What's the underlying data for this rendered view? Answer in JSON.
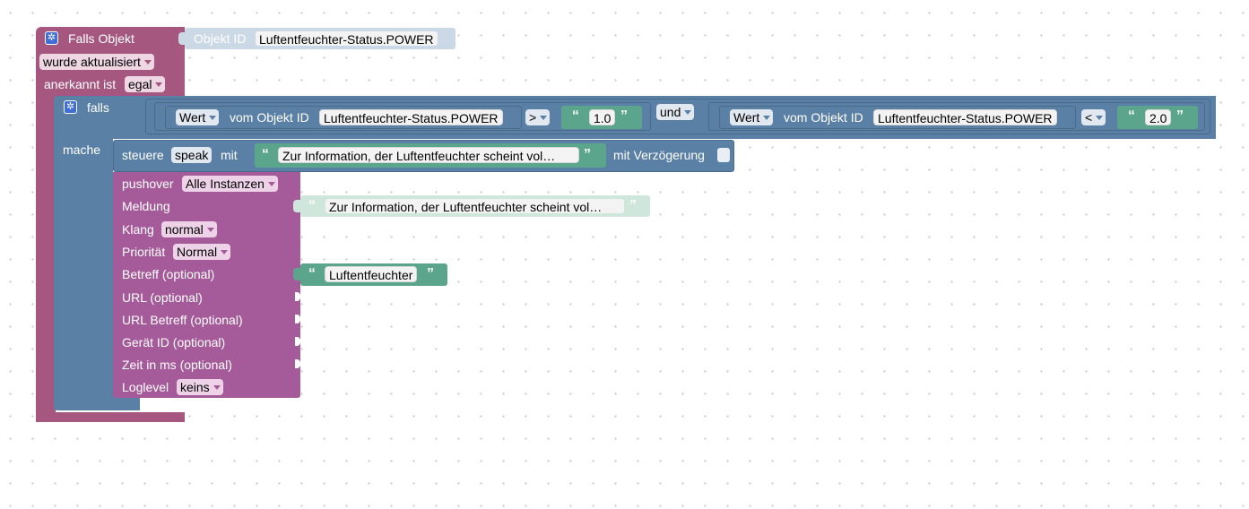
{
  "trigger": {
    "title": "Falls Objekt",
    "event_value": "wurde aktualisiert",
    "ack_label": "anerkannt ist",
    "ack_value": "egal",
    "object_label": "Objekt ID",
    "object_value": "Luftentfeuchter-Status.POWER"
  },
  "if_block": {
    "falls_label": "falls",
    "mache_label": "mache",
    "left": {
      "wert_label": "Wert",
      "vom_label": "vom Objekt ID",
      "object_value": "Luftentfeuchter-Status.POWER",
      "operator": ">",
      "number": "1.0"
    },
    "logic_op": "und",
    "right": {
      "wert_label": "Wert",
      "vom_label": "vom Objekt ID",
      "object_value": "Luftentfeuchter-Status.POWER",
      "operator": "<",
      "number": "2.0"
    }
  },
  "control": {
    "steuere_label": "steuere",
    "target": "speak",
    "mit_label": "mit",
    "text": "Zur Information, der Luftentfeuchter scheint vol…",
    "delay_label": "mit Verzögerung"
  },
  "pushover": {
    "title": "pushover",
    "instance": "Alle Instanzen",
    "meldung_label": "Meldung",
    "meldung_text": "Zur Information, der Luftentfeuchter scheint vol…",
    "klang_label": "Klang",
    "klang_value": "normal",
    "prio_label": "Priorität",
    "prio_value": "Normal",
    "betreff_label": "Betreff (optional)",
    "betreff_text": "Luftentfeuchter",
    "url_label": "URL (optional)",
    "url_betreff_label": "URL Betreff (optional)",
    "geraet_label": "Gerät ID (optional)",
    "zeit_label": "Zeit in ms (optional)",
    "loglevel_label": "Loglevel",
    "loglevel_value": "keins"
  },
  "icons": {
    "gear": "gear-icon",
    "open_quote": "“",
    "close_quote": "”"
  },
  "colors": {
    "trigger": "#a5577f",
    "control": "#5b80a5",
    "pushover": "#a55b99",
    "text": "#5ba58c",
    "gear": "#3f6fd6"
  }
}
